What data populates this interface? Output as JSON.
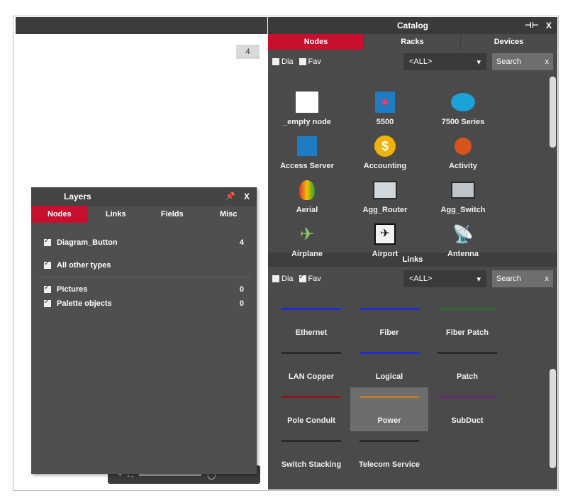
{
  "canvas": {
    "badge": "4"
  },
  "catalog": {
    "title": "Catalog",
    "pin_icon": "pin-icon",
    "close_label": "X",
    "tabs": [
      {
        "label": "Nodes",
        "active": true
      },
      {
        "label": "Racks",
        "active": false
      },
      {
        "label": "Devices",
        "active": false
      }
    ],
    "filter": {
      "dia_label": "Dia",
      "fav_label": "Fav",
      "select_value": "<ALL>",
      "search_label": "Search",
      "search_clear": "x"
    },
    "nodes": [
      {
        "label": "_empty node",
        "icon": "empty-node-icon"
      },
      {
        "label": "5500",
        "icon": "switch-5500-icon"
      },
      {
        "label": "7500 Series",
        "icon": "router-7500-icon"
      },
      {
        "label": "Access Server",
        "icon": "access-server-icon"
      },
      {
        "label": "Accounting",
        "icon": "accounting-icon"
      },
      {
        "label": "Activity",
        "icon": "activity-icon"
      },
      {
        "label": "Aerial",
        "icon": "aerial-icon"
      },
      {
        "label": "Agg_Router",
        "icon": "agg-router-icon"
      },
      {
        "label": "Agg_Switch",
        "icon": "agg-switch-icon"
      },
      {
        "label": "Airplane",
        "icon": "airplane-icon"
      },
      {
        "label": "Airport",
        "icon": "airport-icon"
      },
      {
        "label": "Antenna",
        "icon": "antenna-icon"
      }
    ],
    "links_section": {
      "title": "Links",
      "filter": {
        "dia_label": "Dia",
        "fav_label": "Fav",
        "select_value": "<ALL>",
        "search_label": "Search",
        "search_clear": "x"
      },
      "items": [
        {
          "label": "Ethernet",
          "color": "#1f2bd6"
        },
        {
          "label": "Fiber",
          "color": "#1f2bd6"
        },
        {
          "label": "Fiber Patch",
          "color": "#2e6a2e"
        },
        {
          "label": "LAN Copper",
          "color": "#2a2a2a"
        },
        {
          "label": "Logical",
          "color": "#1f2bd6"
        },
        {
          "label": "Patch",
          "color": "#2a2a2a"
        },
        {
          "label": "Pole Conduit",
          "color": "#8a1a1a"
        },
        {
          "label": "Power",
          "color": "#c07a30",
          "selected": true
        },
        {
          "label": "SubDuct",
          "color": "#6a2a7a"
        },
        {
          "label": "Switch Stacking",
          "color": "#2a2a2a"
        },
        {
          "label": "Telecom Service",
          "color": "#2a2a2a"
        }
      ]
    }
  },
  "layers": {
    "title": "Layers",
    "close_label": "X",
    "tabs": [
      {
        "label": "Nodes",
        "active": true
      },
      {
        "label": "Links",
        "active": false
      },
      {
        "label": "Fields",
        "active": false
      },
      {
        "label": "Misc",
        "active": false
      }
    ],
    "rows": [
      {
        "name": "Diagram_Button",
        "value": "4"
      },
      {
        "name": "All other types",
        "value": ""
      },
      {
        "name": "Pictures",
        "value": "0"
      },
      {
        "name": "Palette objects",
        "value": "0"
      }
    ]
  }
}
